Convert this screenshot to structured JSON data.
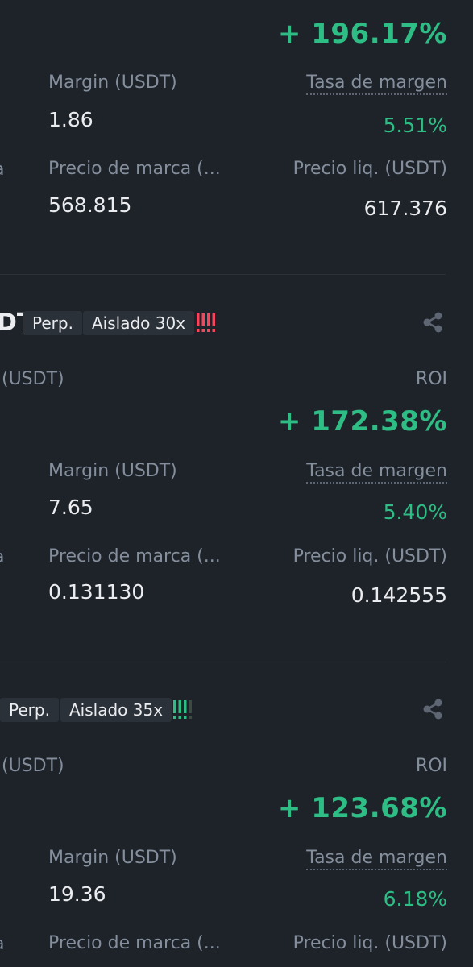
{
  "positions": [
    {
      "roi": "+ 196.17%",
      "margin_label": "Margin (USDT)",
      "margin_value": "1.86",
      "margin_rate_label": "Tasa de margen",
      "margin_rate_value": "5.51%",
      "mark_price_label": "Precio de marca (...",
      "mark_price_value": "568.815",
      "liq_price_label": "Precio liq. (USDT)",
      "liq_price_value": "617.376"
    },
    {
      "symbol_fragment": "DT",
      "tag_type": "Perp.",
      "tag_mode": "Aislado 30x",
      "risk_color": "#f6465d",
      "pnl_label_fragment": "(USDT)",
      "roi_label": "ROI",
      "roi": "+ 172.38%",
      "margin_label": "Margin (USDT)",
      "margin_value": "7.65",
      "margin_rate_label": "Tasa de margen",
      "margin_rate_value": "5.40%",
      "mark_price_label": "Precio de marca (...",
      "mark_price_value": "0.131130",
      "liq_price_label": "Precio liq. (USDT)",
      "liq_price_value": "0.142555"
    },
    {
      "tag_type": "Perp.",
      "tag_mode": "Aislado 35x",
      "risk_color": "#2ebd85",
      "pnl_label_fragment": "(USDT)",
      "roi_label": "ROI",
      "roi": "+ 123.68%",
      "margin_label": "Margin (USDT)",
      "margin_value": "19.36",
      "margin_rate_label": "Tasa de margen",
      "margin_rate_value": "6.18%",
      "mark_price_label": "Precio de marca (...",
      "liq_price_label": "Precio liq. (USDT)"
    }
  ],
  "icons": {
    "share": "share-icon",
    "risk": "risk-bars-icon"
  },
  "colors": {
    "background": "#1e2329",
    "profit": "#2ebd85",
    "loss": "#f6465d",
    "label": "#848e9c"
  }
}
